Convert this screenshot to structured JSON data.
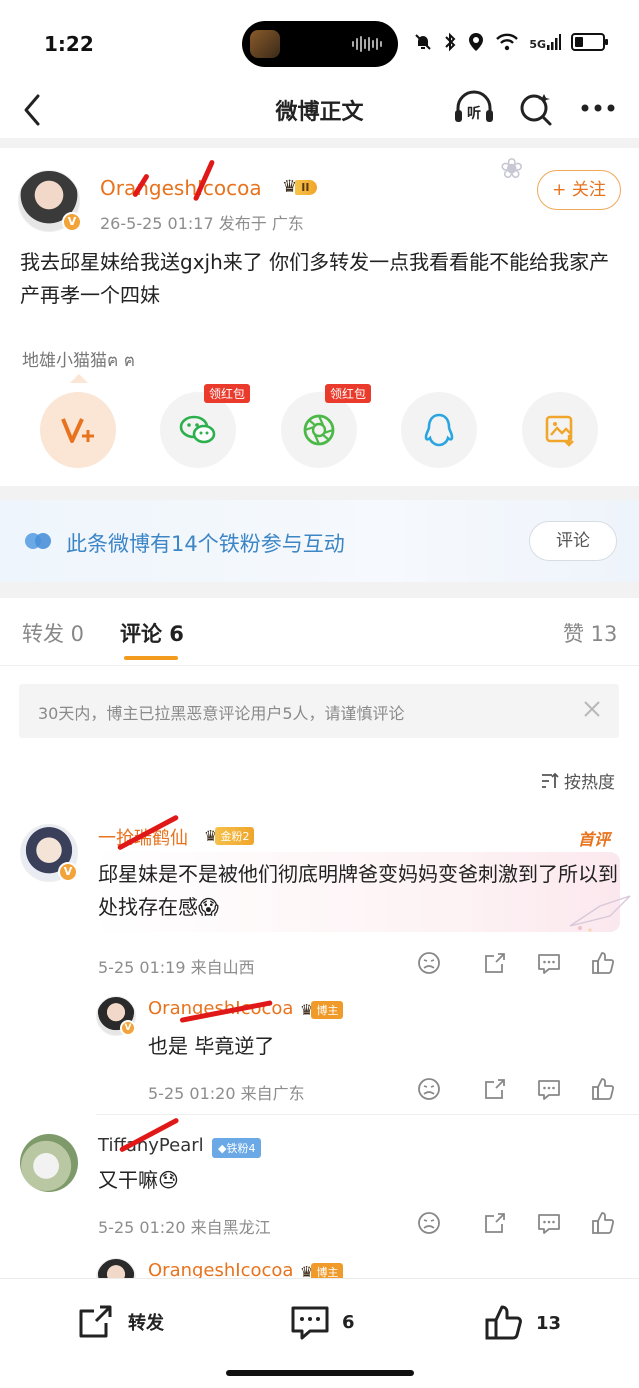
{
  "status": {
    "time": "1:22",
    "network": "5G"
  },
  "nav": {
    "title": "微博正文",
    "listen_label": "听"
  },
  "post": {
    "author": "OrangeshIcocoa",
    "level": "II",
    "meta": "26-5-25 01:17  发布于 广东",
    "follow_label": "+ 关注",
    "text": "我去邱星妹给我送gxjh来了 你们多转发一点我看看能不能给我家产产再孝一个四妹",
    "pet_label": "地雄小猫猫ฅ ฅ",
    "redpack_label": "领红包",
    "share_items": [
      "vip-share",
      "wechat-share",
      "moments-share",
      "qq-share",
      "save-image"
    ]
  },
  "fans_bar": {
    "text": "此条微博有14个铁粉参与互动",
    "button": "评论"
  },
  "tabs": {
    "repost": "转发 0",
    "comment": "评论 6",
    "like": "赞 13"
  },
  "notice": {
    "text": "30天内，博主已拉黑恶意评论用户5人，请谨慎评论"
  },
  "sort_label": "按热度",
  "comments": [
    {
      "name": "一抢瑞鹤仙",
      "badge": "金粉2",
      "tag": "首评",
      "text": "邱星妹是不是被他们彻底明牌爸变妈妈变爸刺激到了所以到处找存在感😱",
      "meta": "5-25 01:19  来自山西"
    },
    {
      "name": "OrangeshIcocoa",
      "badge": "博主",
      "text": "也是 毕竟逆了",
      "meta": "5-25 01:20  来自广东"
    },
    {
      "name": "TiffanyPearl",
      "badge": "铁粉4",
      "text": "又干嘛😓",
      "meta": "5-25 01:20  来自黑龙江"
    },
    {
      "name": "OrangeshIcocoa",
      "badge": "博主"
    }
  ],
  "bottom": {
    "repost": "转发",
    "comment_count": "6",
    "like_count": "13"
  },
  "colors": {
    "accent": "#e8731e",
    "link_blue": "#3d86c6",
    "tab_underline": "#f29b1e",
    "red_markup": "#e01818"
  }
}
